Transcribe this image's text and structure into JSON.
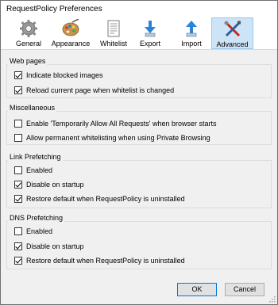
{
  "window": {
    "title": "RequestPolicy Preferences"
  },
  "tabs": [
    {
      "label": "General",
      "icon": "gear-icon"
    },
    {
      "label": "Appearance",
      "icon": "palette-icon"
    },
    {
      "label": "Whitelist",
      "icon": "document-list-icon"
    },
    {
      "label": "Export",
      "icon": "export-arrow-icon"
    },
    {
      "label": "Import",
      "icon": "import-arrow-icon"
    },
    {
      "label": "Advanced",
      "icon": "tools-icon"
    }
  ],
  "selected_tab": "Advanced",
  "groups": {
    "web_pages": {
      "title": "Web pages",
      "items": [
        {
          "label": "Indicate blocked images",
          "checked": true
        },
        {
          "label": "Reload current page when whitelist is changed",
          "checked": true
        }
      ]
    },
    "misc": {
      "title": "Miscellaneous",
      "items": [
        {
          "label": "Enable 'Temporarily Allow All Requests' when browser starts",
          "checked": false
        },
        {
          "label": "Allow permanent whitelisting when using Private Browsing",
          "checked": false
        }
      ]
    },
    "link_prefetch": {
      "title": "Link Prefetching",
      "items": [
        {
          "label": "Enabled",
          "checked": false
        },
        {
          "label": "Disable on startup",
          "checked": true
        },
        {
          "label": "Restore default when RequestPolicy is uninstalled",
          "checked": true
        }
      ]
    },
    "dns_prefetch": {
      "title": "DNS Prefetching",
      "items": [
        {
          "label": "Enabled",
          "checked": false
        },
        {
          "label": "Disable on startup",
          "checked": true
        },
        {
          "label": "Restore default when RequestPolicy is uninstalled",
          "checked": true
        }
      ]
    }
  },
  "buttons": {
    "ok": "OK",
    "cancel": "Cancel"
  },
  "colors": {
    "selected_tab_bg": "#cde4f7",
    "selected_tab_border": "#99c9ef",
    "default_button_border": "#0078d7"
  }
}
